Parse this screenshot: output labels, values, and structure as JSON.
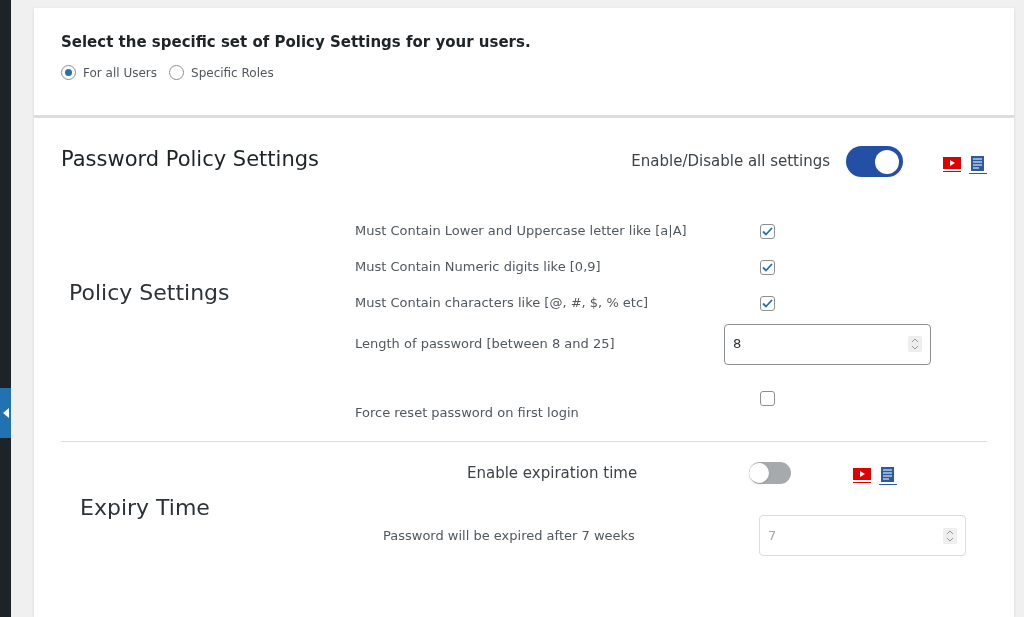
{
  "scope": {
    "title": "Select the specific set of Policy Settings for your users.",
    "options": [
      {
        "label": "For all Users",
        "selected": true
      },
      {
        "label": "Specific Roles",
        "selected": false
      }
    ]
  },
  "password_policy": {
    "title": "Password Policy Settings",
    "toggle_label": "Enable/Disable all settings",
    "on": true
  },
  "policy_settings": {
    "heading": "Policy Settings",
    "rows": [
      {
        "kind": "checkbox",
        "label": "Must Contain Lower and Uppercase letter like [a|A]",
        "checked": true
      },
      {
        "kind": "checkbox",
        "label": "Must Contain Numeric digits like [0,9]",
        "checked": true
      },
      {
        "kind": "checkbox",
        "label": "Must Contain characters like [@, #, $, % etc]",
        "checked": true
      },
      {
        "kind": "number",
        "label": "Length of password [between 8 and 25]",
        "value": "8"
      },
      {
        "kind": "checkbox",
        "label": "Force reset password on first login",
        "checked": false
      }
    ]
  },
  "expiry": {
    "heading": "Expiry Time",
    "toggle_label": "Enable expiration time",
    "on": false,
    "field_label": "Password will be expired after 7 weeks",
    "value": "7",
    "disabled": true
  }
}
